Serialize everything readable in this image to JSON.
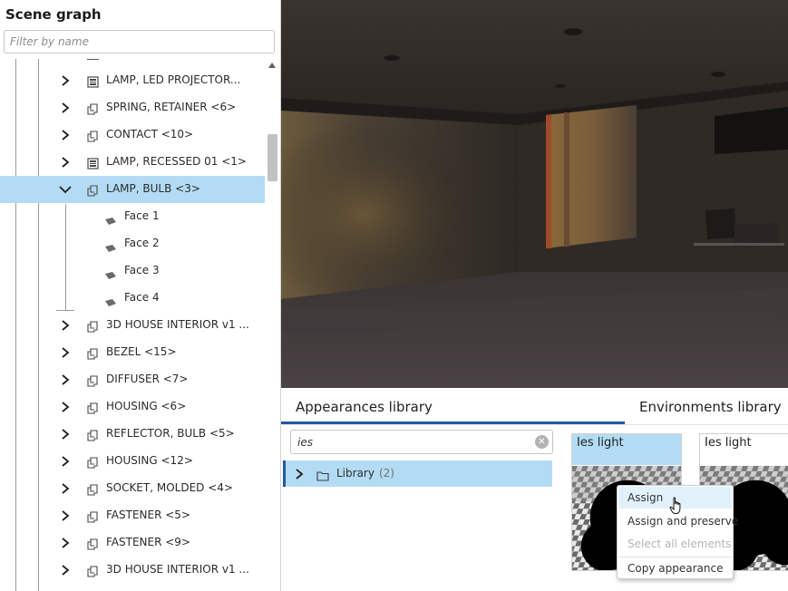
{
  "scene_graph": {
    "title": "Scene graph",
    "filter_placeholder": "Filter by name",
    "items": [
      {
        "label": "LAMP, LED PROJECTOR...",
        "kind": "assembly-icon"
      },
      {
        "label": "SPRING, RETAINER <6>",
        "kind": "part-icon"
      },
      {
        "label": "CONTACT <10>",
        "kind": "part-icon"
      },
      {
        "label": "LAMP, RECESSED 01 <1>",
        "kind": "assembly-icon"
      },
      {
        "label": "LAMP, BULB <3>",
        "kind": "part-icon",
        "expanded": true,
        "selected": true
      },
      {
        "label": "3D HOUSE INTERIOR v1 ...",
        "kind": "part-icon"
      },
      {
        "label": "BEZEL <15>",
        "kind": "part-icon"
      },
      {
        "label": "DIFFUSER <7>",
        "kind": "part-icon"
      },
      {
        "label": "HOUSING <6>",
        "kind": "part-icon"
      },
      {
        "label": "REFLECTOR, BULB <5>",
        "kind": "part-icon"
      },
      {
        "label": "HOUSING <12>",
        "kind": "part-icon"
      },
      {
        "label": "SOCKET, MOLDED <4>",
        "kind": "part-icon"
      },
      {
        "label": "FASTENER <5>",
        "kind": "part-icon"
      },
      {
        "label": "FASTENER <9>",
        "kind": "part-icon"
      },
      {
        "label": "3D HOUSE INTERIOR v1 ...",
        "kind": "part-icon"
      }
    ],
    "faces": [
      "Face 1",
      "Face 2",
      "Face 3",
      "Face 4"
    ]
  },
  "library": {
    "tabs": {
      "appearances": "Appearances library",
      "environments": "Environments library"
    },
    "search_value": "ies",
    "clear_icon": "clear-search-icon",
    "folder": {
      "label": "Library",
      "count": "(2)"
    },
    "cards": [
      {
        "label": "Ies light",
        "selected": true
      },
      {
        "label": "Ies light",
        "selected": false
      }
    ]
  },
  "context_menu": {
    "items": [
      {
        "label": "Assign",
        "state": "hover"
      },
      {
        "label": "Assign and preserve",
        "state": "normal"
      },
      {
        "label": "Select all elements",
        "state": "disabled"
      },
      {
        "label": "Copy appearance",
        "state": "normal"
      }
    ]
  },
  "colors": {
    "selection": "#b3dcf4",
    "accent": "#2357a8",
    "viewport_dark": "#2a2420"
  }
}
